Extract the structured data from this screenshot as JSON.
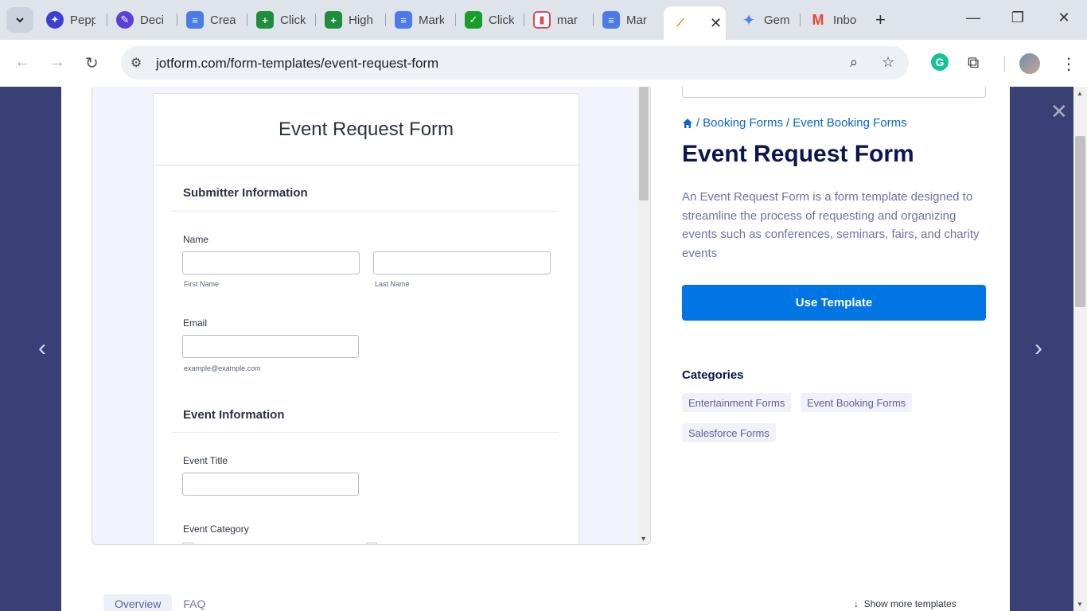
{
  "browser": {
    "tabs": [
      {
        "label": "Pepp",
        "icon": "compass-icon",
        "color": "#3b3fd6"
      },
      {
        "label": "Deci",
        "icon": "pen-icon",
        "color": "#5b3fd6"
      },
      {
        "label": "Crea",
        "icon": "docs-icon",
        "color": "#4a7be8"
      },
      {
        "label": "Click",
        "icon": "sheets-plus-icon",
        "color": "#1e8e3e"
      },
      {
        "label": "High",
        "icon": "sheets-plus-icon",
        "color": "#1e8e3e"
      },
      {
        "label": "Mark",
        "icon": "docs-icon",
        "color": "#4a7be8"
      },
      {
        "label": "Click",
        "icon": "check-icon",
        "color": "#1a9c2a"
      },
      {
        "label": "mar",
        "icon": "chart-icon",
        "color": "#e04a5a"
      },
      {
        "label": "Mar",
        "icon": "docs-icon",
        "color": "#4a7be8"
      },
      {
        "label": "",
        "icon": "jotform-icon",
        "color": "#ff6100",
        "active": true
      },
      {
        "label": "Gem",
        "icon": "sparkle-icon",
        "color": "#4285f4"
      },
      {
        "label": "Inbo",
        "icon": "gmail-icon",
        "color": "#ea4335"
      }
    ],
    "url": "jotform.com/form-templates/event-request-form"
  },
  "form": {
    "title": "Event Request Form",
    "section1": "Submitter Information",
    "name_label": "Name",
    "first_name": "First Name",
    "last_name": "Last Name",
    "email_label": "Email",
    "email_hint": "example@example.com",
    "section2": "Event Information",
    "event_title_label": "Event Title",
    "event_category_label": "Event Category"
  },
  "side": {
    "breadcrumb": [
      "Booking Forms",
      "Event Booking Forms"
    ],
    "title": "Event Request Form",
    "description": "An Event Request Form is a form template designed to streamline the process of requesting and organizing events such as conferences, seminars, fairs, and charity events",
    "use_template": "Use Template",
    "categories_title": "Categories",
    "categories": [
      "Entertainment Forms",
      "Event Booking Forms",
      "Salesforce Forms"
    ]
  },
  "bottom": {
    "tabs": [
      "Overview",
      "FAQ"
    ],
    "show_more": "Show more templates"
  }
}
